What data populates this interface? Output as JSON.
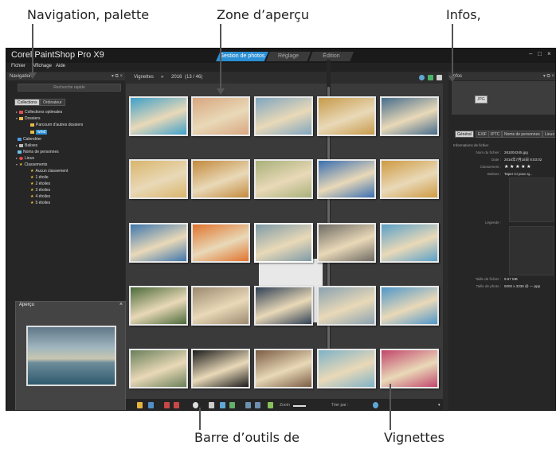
{
  "callouts": {
    "left": "Navigation, palette",
    "center": "Zone d’aperçu",
    "right": "Infos,",
    "bottom_left": "Barre d’outils de",
    "bottom_right": "Vignettes"
  },
  "app": {
    "title": "Corel PaintShop Pro X9",
    "workspace_tabs": [
      "Gestion de photos",
      "Réglage",
      "Édition"
    ],
    "window_controls": [
      "–",
      "□",
      "×"
    ],
    "menus": [
      "Fichier",
      "Affichage",
      "Aide"
    ]
  },
  "navigation": {
    "title": "Navigation",
    "controls": "▾ ⧉ ×",
    "search_placeholder": "Recherche rapide",
    "tabs": [
      "Collections",
      "Ordinateur"
    ],
    "tree": [
      "Collections optimales",
      "Dossiers",
      "Parcourir d'autres dossiers",
      "wind",
      "Calendrier",
      "Balises",
      "Noms de personnes",
      "Lieux",
      "Classements",
      "Aucun classement",
      "1 étoile",
      "2 étoiles",
      "3 étoiles",
      "4 étoiles",
      "5 étoiles"
    ]
  },
  "preview": {
    "title": "Aperçu",
    "close": "×"
  },
  "thumbnails_header": {
    "label": "Vignettes",
    "separator": "»",
    "path": "2016",
    "count": "(13 / 46)"
  },
  "thumbnails": [
    "#3ea0c9",
    "#d8a680",
    "#7fa5c0",
    "#c79a4a",
    "#466d8c",
    "#d9b56c",
    "#c38a3c",
    "#a8b07a",
    "#3a6fb0",
    "#cf9a42",
    "#3f77ad",
    "#e0732c",
    "#7e9aa6",
    "#6e6a64",
    "#5aa0c8",
    "#4b6a3a",
    "#9c8a70",
    "#2f3f55",
    "#8aa2b0",
    "#4f97c9",
    "#6a7f5a",
    "#1c1c1c",
    "#7a5c44",
    "#7fb2c7",
    "#c2466c"
  ],
  "toolbar": {
    "zoom": "Zoom",
    "sort": "Trier par :"
  },
  "info": {
    "title": "Infos",
    "badge": "JPG",
    "tabs": [
      "Général",
      "EXIF",
      "IPTC",
      "Noms de personnes",
      "Lieux"
    ],
    "section": "Informations de fichier",
    "fields": [
      {
        "label": "Nom du fichier :",
        "value": "261004345.jpg"
      },
      {
        "label": "Date :",
        "value": "2016年7月18日 8:03:02"
      },
      {
        "label": "Classement :",
        "value": "★ ★ ★ ★ ★"
      },
      {
        "label": "Balises :",
        "value": "Taper ici pour aj..."
      }
    ],
    "legend_label": "Légende :",
    "size_label": "Taille de fichier :",
    "size_value": "9.67 MB",
    "photo_label": "Taille de photo :",
    "photo_value": "5000 x 3336 @ — ppp"
  }
}
